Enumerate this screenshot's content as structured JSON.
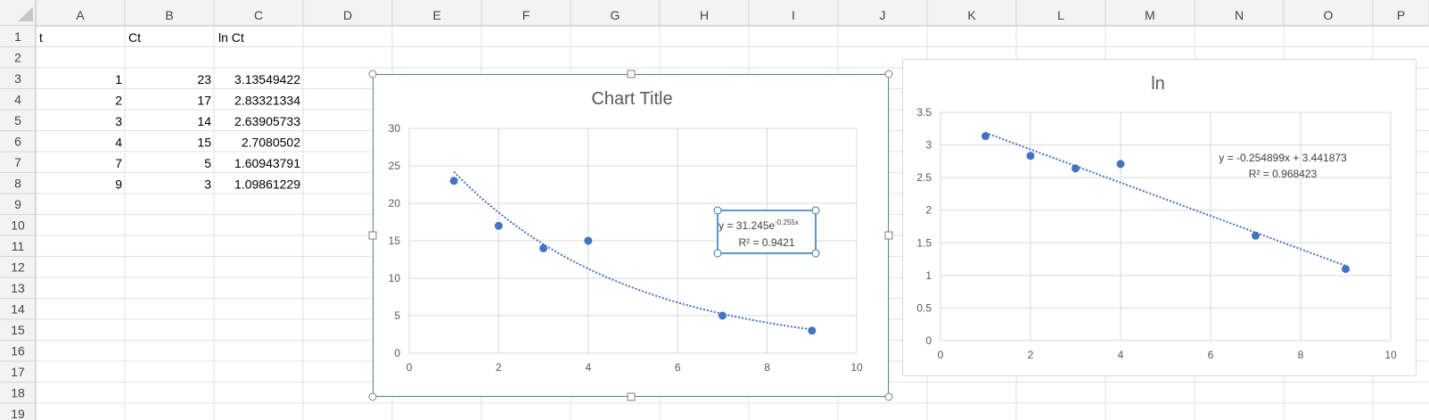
{
  "sheet": {
    "columns": [
      "A",
      "B",
      "C",
      "D",
      "E",
      "F",
      "G",
      "H",
      "I",
      "J",
      "K",
      "L",
      "M",
      "N",
      "O",
      "P"
    ],
    "rows": [
      "1",
      "2",
      "3",
      "4",
      "5",
      "6",
      "7",
      "8",
      "9",
      "10",
      "11",
      "12",
      "13",
      "14",
      "15",
      "16",
      "17",
      "18",
      "19"
    ],
    "headers": {
      "a1": "t",
      "b1": "Ct",
      "c1": "ln Ct"
    },
    "data": [
      {
        "t": "1",
        "ct": "23",
        "ln": "3.13549422"
      },
      {
        "t": "2",
        "ct": "17",
        "ln": "2.83321334"
      },
      {
        "t": "3",
        "ct": "14",
        "ln": "2.63905733"
      },
      {
        "t": "4",
        "ct": "15",
        "ln": "2.7080502"
      },
      {
        "t": "7",
        "ct": "5",
        "ln": "1.60943791"
      },
      {
        "t": "9",
        "ct": "3",
        "ln": "1.09861229"
      }
    ]
  },
  "chart_data": [
    {
      "type": "scatter",
      "title": "Chart Title",
      "x": [
        1,
        2,
        3,
        4,
        7,
        9
      ],
      "y": [
        23,
        17,
        14,
        15,
        5,
        3
      ],
      "xlim": [
        0,
        10
      ],
      "ylim": [
        0,
        30
      ],
      "xticks": [
        "0",
        "2",
        "4",
        "6",
        "8",
        "10"
      ],
      "yticks": [
        "0",
        "5",
        "10",
        "15",
        "20",
        "25",
        "30"
      ],
      "grid": true,
      "trendline": {
        "type": "exponential",
        "a": 31.245,
        "b": -0.255
      },
      "equation": {
        "base": "y = 31.245e",
        "exponent": "-0.255x",
        "r2": "R² = 0.9421"
      },
      "marker_color": "#4472c4"
    },
    {
      "type": "scatter",
      "title": "ln",
      "x": [
        1,
        2,
        3,
        4,
        7,
        9
      ],
      "y": [
        3.13549422,
        2.83321334,
        2.63905733,
        2.7080502,
        1.60943791,
        1.09861229
      ],
      "xlim": [
        0,
        10
      ],
      "ylim": [
        0,
        3.5
      ],
      "xticks": [
        "0",
        "2",
        "4",
        "6",
        "8",
        "10"
      ],
      "yticks": [
        "0",
        "0.5",
        "1",
        "1.5",
        "2",
        "2.5",
        "3",
        "3.5"
      ],
      "grid": true,
      "trendline": {
        "type": "linear",
        "slope": -0.254899,
        "intercept": 3.441873
      },
      "equation": {
        "text": "y = -0.254899x + 3.441873",
        "r2": "R² = 0.968423"
      },
      "marker_color": "#4472c4"
    }
  ]
}
